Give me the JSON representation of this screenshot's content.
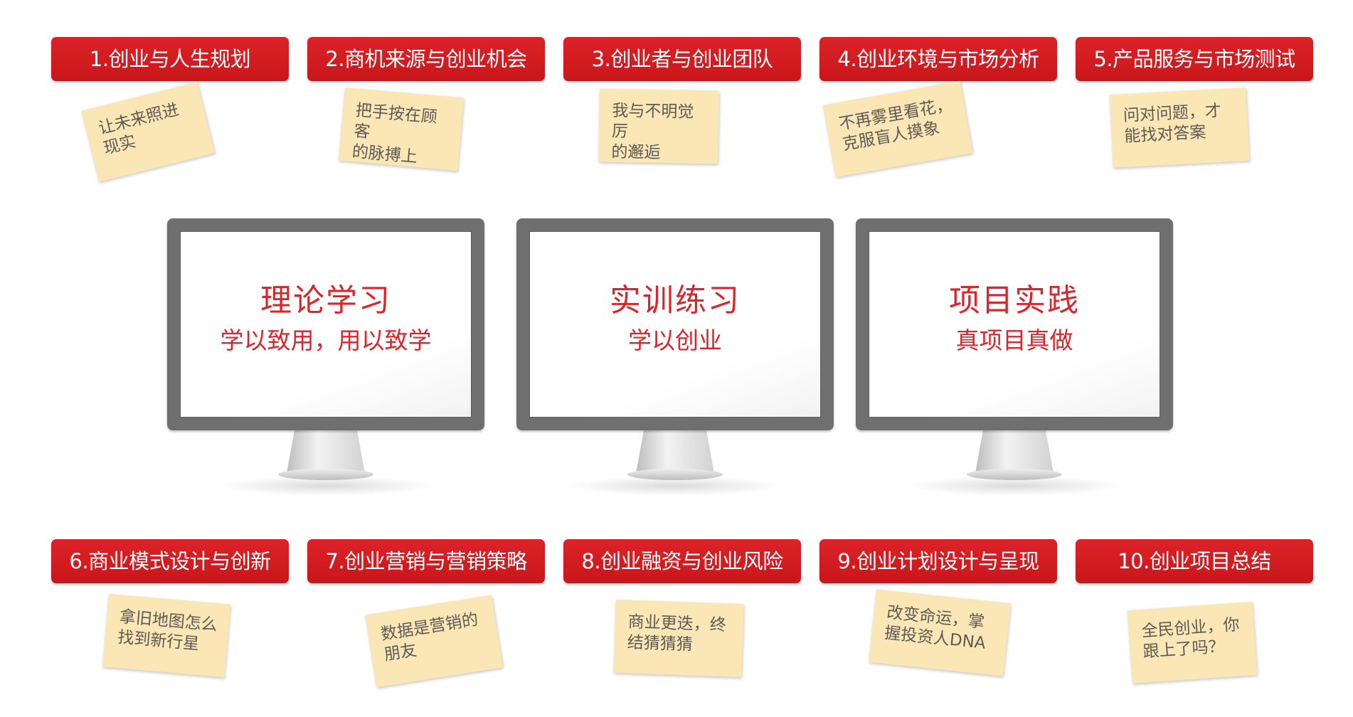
{
  "colors": {
    "badge": "#d3191e",
    "note": "#fbe6b6",
    "accent_text": "#d9262c"
  },
  "modules": [
    {
      "label": "1.创业与人生规划",
      "note": [
        "让未来照进",
        "现实"
      ]
    },
    {
      "label": "2.商机来源与创业机会",
      "note": [
        "把手按在顾客",
        "的脉搏上"
      ]
    },
    {
      "label": "3.创业者与创业团队",
      "note": [
        "我与不明觉厉",
        "的邂逅"
      ]
    },
    {
      "label": "4.创业环境与市场分析",
      "note": [
        "不再雾里看花，",
        "克服盲人摸象"
      ]
    },
    {
      "label": "5.产品服务与市场测试",
      "note": [
        "问对问题，才",
        "能找对答案"
      ]
    },
    {
      "label": "6.商业模式设计与创新",
      "note": [
        "拿旧地图怎么",
        "找到新行星"
      ]
    },
    {
      "label": "7.创业营销与营销策略",
      "note": [
        "数据是营销的",
        "朋友"
      ]
    },
    {
      "label": "8.创业融资与创业风险",
      "note": [
        "商业更迭，终",
        "结猜猜猜"
      ]
    },
    {
      "label": "9.创业计划设计与呈现",
      "note": [
        "改变命运，掌",
        "握投资人DNA"
      ]
    },
    {
      "label": "10.创业项目总结",
      "note": [
        "全民创业，你",
        "跟上了吗？"
      ]
    }
  ],
  "monitors": [
    {
      "title": "理论学习",
      "subtitle": "学以致用，用以致学"
    },
    {
      "title": "实训练习",
      "subtitle": "学以创业"
    },
    {
      "title": "项目实践",
      "subtitle": "真项目真做"
    }
  ]
}
